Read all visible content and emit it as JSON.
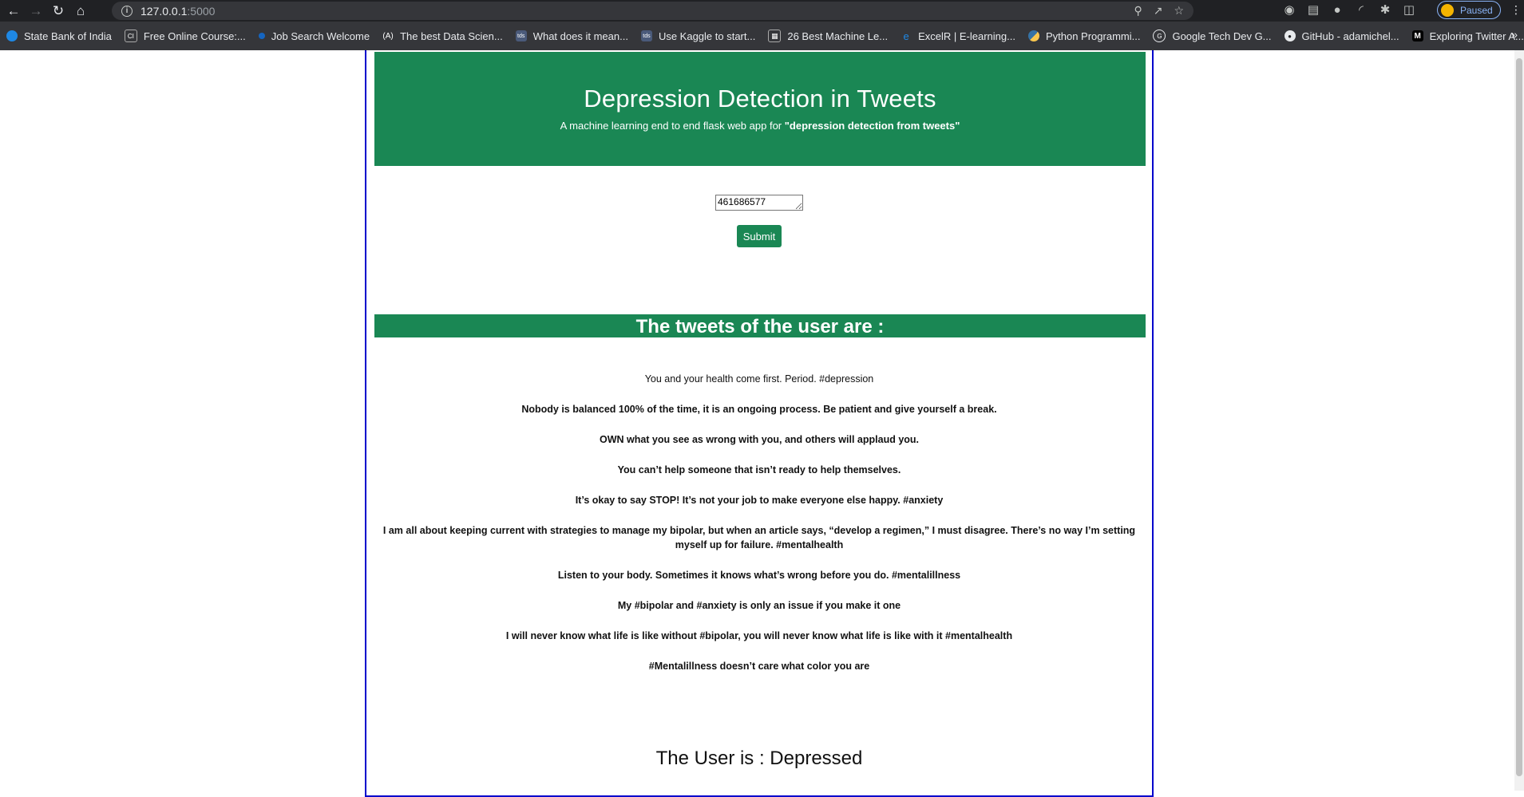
{
  "browser": {
    "url_host": "127.0.0.1",
    "url_port": ":5000",
    "profile_label": "Paused",
    "bookmarks": [
      {
        "label": "State Bank of India",
        "icon": "sbi-icon",
        "color": "#1e88e5"
      },
      {
        "label": "Free Online Course:...",
        "icon": "course-icon",
        "color": "#5f6368"
      },
      {
        "label": "Job Search Welcome",
        "icon": "job-icon",
        "color": "#1565c0"
      },
      {
        "label": "The best Data Scien...",
        "icon": "analytics-icon",
        "color": "#3c4043"
      },
      {
        "label": "What does it mean...",
        "icon": "tds-icon",
        "color": "#4a5a7a"
      },
      {
        "label": "Use Kaggle to start...",
        "icon": "tds-icon",
        "color": "#4a5a7a"
      },
      {
        "label": "26 Best Machine Le...",
        "icon": "grid-icon",
        "color": "#5f6368"
      },
      {
        "label": "ExcelR | E-learning...",
        "icon": "excelr-icon",
        "color": "#1e88e5"
      },
      {
        "label": "Python Programmi...",
        "icon": "python-icon",
        "color": "#f9a825"
      },
      {
        "label": "Google Tech Dev G...",
        "icon": "google-icon",
        "color": "#5f6368"
      },
      {
        "label": "GitHub - adamichel...",
        "icon": "github-icon",
        "color": "#202124"
      },
      {
        "label": "Exploring Twitter A...",
        "icon": "medium-icon",
        "color": "#000000"
      }
    ]
  },
  "header": {
    "title": "Depression Detection in Tweets",
    "subtitle_prefix": "A machine learning end to end flask web app for ",
    "subtitle_bold": "\"depression detection from tweets\""
  },
  "form": {
    "input_value": "461686577",
    "submit_label": "Submit"
  },
  "section": {
    "title": "The tweets of the user are :"
  },
  "tweets": [
    "You and your health come first. Period. #depression",
    "Nobody is balanced 100% of the time, it is an ongoing process. Be patient and give yourself a break.",
    "OWN what you see as wrong with you, and others will applaud you.",
    "You can’t help someone that isn’t ready to help themselves.",
    "It’s okay to say STOP! It’s not your job to make everyone else happy. #anxiety",
    "I am all about keeping current with strategies to manage my bipolar, but when an article says, “develop a regimen,” I must disagree. There’s no way I’m setting myself up for failure. #mentalhealth",
    "Listen to your body. Sometimes it knows what’s wrong before you do. #mentalillness",
    "My #bipolar and #anxiety is only an issue if you make it one",
    "I will never know what life is like without #bipolar, you will never know what life is like with it #mentalhealth",
    "#Mentalillness doesn’t care what color you are"
  ],
  "result": {
    "text": "The User is : Depressed"
  },
  "colors": {
    "accent": "#1a8754",
    "container_border": "#0000cc"
  }
}
